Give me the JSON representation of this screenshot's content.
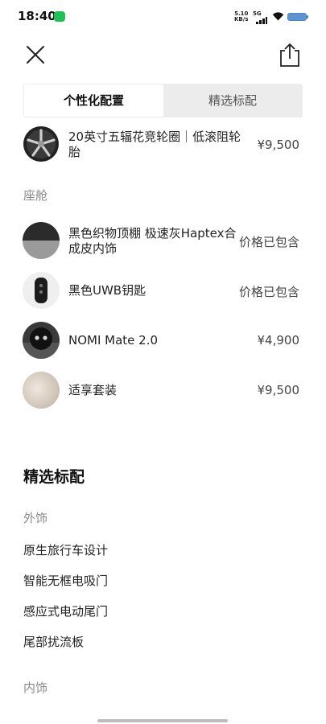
{
  "status_bar": {
    "time": "18:40",
    "net_speed": "5.10",
    "net_unit": "KB/s",
    "network": "5G"
  },
  "tabs": {
    "personalized": "个性化配置",
    "standard": "精选标配"
  },
  "items": [
    {
      "name": "20英寸五辐花竞轮圈｜低滚阻轮胎",
      "price": "¥9,500"
    },
    {
      "name": "黑色织物顶棚 极速灰Haptex合成皮内饰",
      "price": "价格已包含"
    },
    {
      "name": "黑色UWB钥匙",
      "price": "价格已包含"
    },
    {
      "name": "NOMI Mate 2.0",
      "price": "¥4,900"
    },
    {
      "name": "适享套装",
      "price": "¥9,500"
    }
  ],
  "sections": {
    "cabin": "座舱",
    "standard_heading": "精选标配",
    "exterior": "外饰",
    "interior": "内饰"
  },
  "exterior_features": [
    "原生旅行车设计",
    "智能无框电吸门",
    "感应式电动尾门",
    "尾部扰流板"
  ]
}
